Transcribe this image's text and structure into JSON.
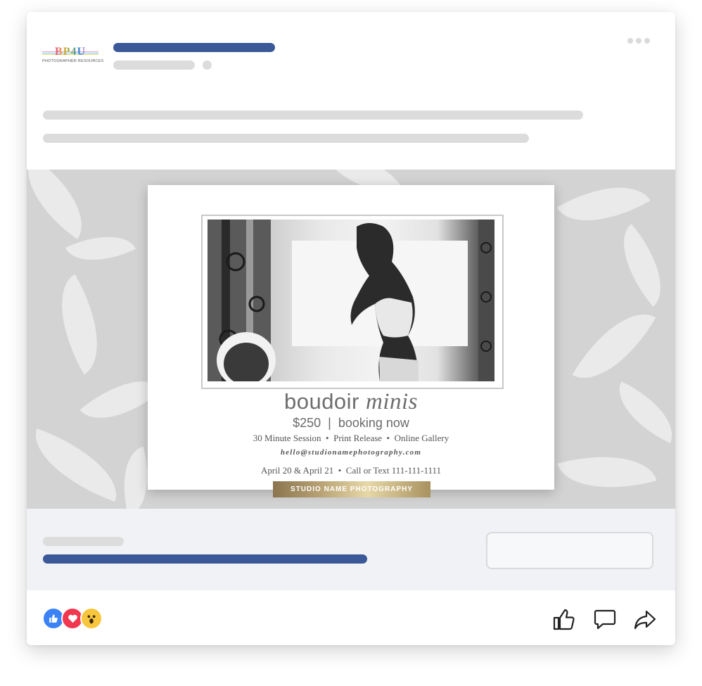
{
  "post": {
    "logo_text": "BP4U",
    "logo_subtext": "PHOTOGRAPHER RESOURCES",
    "more_icon": "more-horizontal-icon"
  },
  "flyer": {
    "title_plain": "boudoir ",
    "title_italic": "minis",
    "price_line": "$250  |  booking now",
    "session_line": "30 Minute Session  •  Print Release  •  Online Gallery",
    "email": "hello@studionamephotography.com",
    "dates_line": "April 20 & April 21  •  Call or Text 111-111-1111",
    "studio_name": "STUDIO NAME PHOTOGRAPHY"
  },
  "footer": {
    "reactions": [
      "like-reaction-icon",
      "love-reaction-icon",
      "wow-reaction-icon"
    ],
    "actions": [
      "like-icon",
      "comment-icon",
      "share-icon"
    ]
  },
  "colors": {
    "brand_blue": "#3b5998",
    "placeholder_gray": "#dcdcdc",
    "like_blue": "#3b82f6",
    "love_red": "#f0384f",
    "wow_yellow": "#f8c63d"
  }
}
